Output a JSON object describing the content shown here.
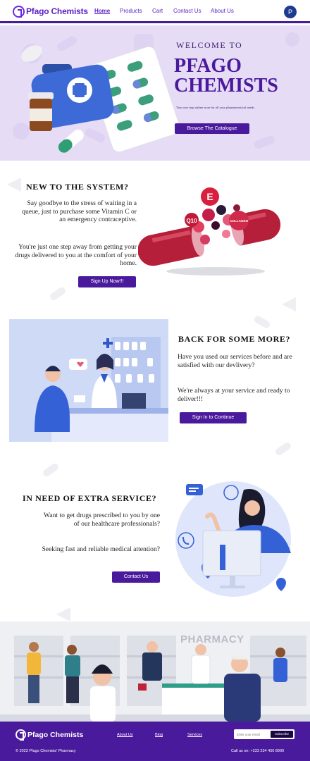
{
  "nav": {
    "logo_text": "Pfago Chemists",
    "links": [
      "Home",
      "Products",
      "Cart",
      "Contact Us",
      "About Us"
    ],
    "avatar_initial": "P"
  },
  "hero": {
    "welcome": "WELCOME TO",
    "title_line1": "PFAGO",
    "title_line2": "CHEMISTS",
    "tagline": "Your one stop online store for all your pharmaceutical needs",
    "button": "Browse The Catalogue"
  },
  "section_new": {
    "title": "NEW TO THE SYSTEM?",
    "text1": "Say goodbye to the stress of waiting in a queue, just to purchase some Vitamin C or an emergency contraceptive.",
    "text2": "You're just one step away from getting your drugs delivered to you at the comfort of your home.",
    "button": "Sign Up Now!!!",
    "capsule_labels": [
      "E",
      "Q10",
      "COLLAGEN"
    ]
  },
  "section_back": {
    "title": "BACK FOR SOME MORE?",
    "text1": "Have you used our services before and are satisfied with our devlivery?",
    "text2": "We're always at your service and ready to deliver!!!",
    "button": "Sign In to Continue"
  },
  "section_extra": {
    "title": "IN NEED OF EXTRA SERVICE?",
    "text1": "Want to get drugs prescribed to you by one of our healthcare professionals?",
    "text2": "Seeking fast and reliable medical attention?",
    "button": "Contact Us"
  },
  "pharmacy": {
    "sign": "PHARMACY"
  },
  "footer": {
    "logo_text": "Pfago Chemists",
    "links": [
      "About Us",
      "Blog",
      "Services"
    ],
    "email_placeholder": "Enter your email",
    "subscribe": "Subscribe",
    "copyright": "© 2023 Pfago Chemists' Pharmacy",
    "call": "Call us on: +233 234 456 8990"
  },
  "colors": {
    "brand": "#4a1a9c",
    "hero_bg": "#e6dcf5",
    "illustration_bg": "#cfdaf7"
  }
}
